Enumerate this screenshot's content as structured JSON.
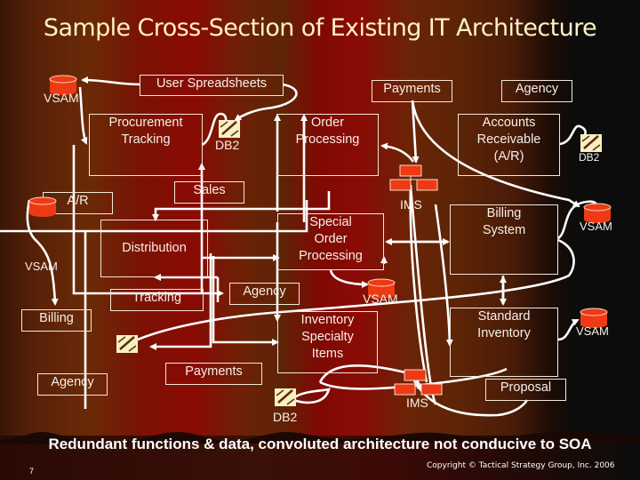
{
  "slide": {
    "title": "Sample Cross-Section of Existing IT Architecture",
    "summary": "Redundant functions & data, convoluted architecture not conducive to SOA",
    "page_number": "7",
    "copyright": "Copyright © Tactical Strategy Group, Inc. 2006"
  },
  "colors": {
    "box_border": "#f2e8d8",
    "text": "#f6efe6",
    "vsam_fill": "#ee3a14",
    "ims_fill": "#ee3a14",
    "db2_fill": "#f8f0c0",
    "connector": "#ffffff"
  },
  "systems": [
    {
      "id": "user-spreadsheets",
      "label": "User Spreadsheets"
    },
    {
      "id": "payments-top",
      "label": "Payments"
    },
    {
      "id": "agency-top",
      "label": "Agency"
    },
    {
      "id": "procurement-tracking",
      "label": "Procurement\nTracking"
    },
    {
      "id": "order-processing",
      "label": "Order\nProcessing"
    },
    {
      "id": "accounts-receivable",
      "label": "Accounts\nReceivable\n(A/R)"
    },
    {
      "id": "sales",
      "label": "Sales"
    },
    {
      "id": "ar",
      "label": "A/R"
    },
    {
      "id": "special-order-processing",
      "label": "Special\nOrder\nProcessing"
    },
    {
      "id": "billing-system",
      "label": "Billing\nSystem"
    },
    {
      "id": "distribution",
      "label": "Distribution"
    },
    {
      "id": "tracking",
      "label": "Tracking"
    },
    {
      "id": "agency-mid",
      "label": "Agency"
    },
    {
      "id": "billing",
      "label": "Billing"
    },
    {
      "id": "inventory-specialty-items",
      "label": "Inventory\nSpecialty\nItems"
    },
    {
      "id": "standard-inventory",
      "label": "Standard\nInventory"
    },
    {
      "id": "agency-bottom",
      "label": "Agency"
    },
    {
      "id": "payments-bottom",
      "label": "Payments"
    },
    {
      "id": "proposal",
      "label": "Proposal"
    }
  ],
  "datastores": [
    {
      "id": "vsam-1",
      "type": "VSAM",
      "label": "VSAM"
    },
    {
      "id": "db2-1",
      "type": "DB2",
      "label": "DB2"
    },
    {
      "id": "db2-2",
      "type": "DB2",
      "label": "DB2"
    },
    {
      "id": "ims-1",
      "type": "IMS",
      "label": "IMS"
    },
    {
      "id": "vsam-2",
      "type": "VSAM",
      "label": "VSAM"
    },
    {
      "id": "vsam-3",
      "type": "VSAM",
      "label": "VSAM"
    },
    {
      "id": "vsam-4",
      "type": "VSAM",
      "label": "VSAM"
    },
    {
      "id": "vsam-5",
      "type": "VSAM",
      "label": "VSAM"
    },
    {
      "id": "db2-3",
      "type": "DB2",
      "label": ""
    },
    {
      "id": "db2-4",
      "type": "DB2",
      "label": "DB2"
    },
    {
      "id": "ims-2",
      "type": "IMS",
      "label": "IMS"
    }
  ]
}
